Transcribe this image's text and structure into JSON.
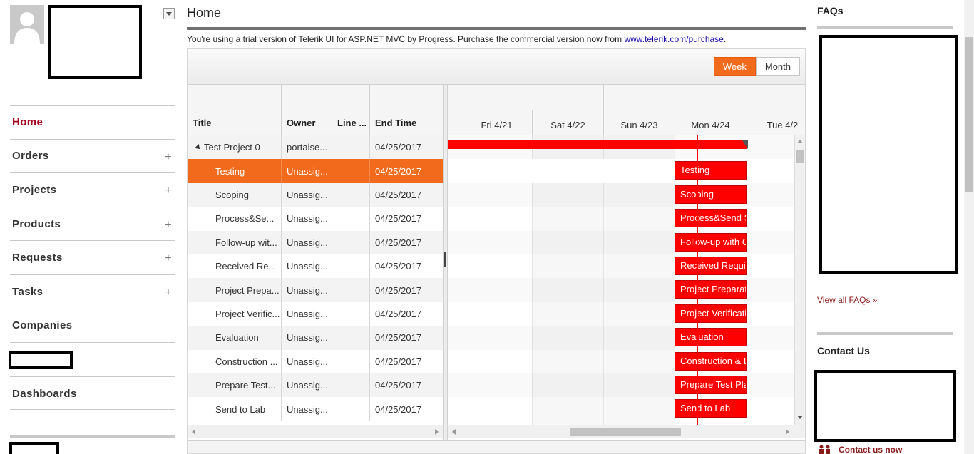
{
  "sidebar": {
    "nav": [
      {
        "label": "Home",
        "expandable": false,
        "active": true
      },
      {
        "label": "Orders",
        "expandable": true
      },
      {
        "label": "Projects",
        "expandable": true
      },
      {
        "label": "Products",
        "expandable": true
      },
      {
        "label": "Requests",
        "expandable": true
      },
      {
        "label": "Tasks",
        "expandable": true
      },
      {
        "label": "Companies",
        "expandable": false
      },
      {
        "label": "",
        "redacted": true
      },
      {
        "label": "Dashboards",
        "expandable": false
      }
    ],
    "plus_glyph": "+"
  },
  "main": {
    "title": "Home",
    "trial_notice": "You're using a trial version of Telerik UI for ASP.NET MVC by Progress. Purchase the commercial version now from",
    "trial_link": "www.telerik.com/purchase",
    "trial_suffix": "."
  },
  "gantt": {
    "views": [
      "Week",
      "Month"
    ],
    "selected_view": "Week",
    "columns": [
      "Title",
      "Owner",
      "Line ...",
      "End Time"
    ],
    "rows": [
      {
        "title": "Test Project 0",
        "owner": "portalse...",
        "line": "",
        "end": "04/25/2017",
        "summary": true
      },
      {
        "title": "Testing",
        "owner": "Unassig...",
        "line": "",
        "end": "04/25/2017",
        "selected": true
      },
      {
        "title": "Scoping",
        "owner": "Unassig...",
        "line": "",
        "end": "04/25/2017"
      },
      {
        "title": "Process&Se...",
        "owner": "Unassig...",
        "line": "",
        "end": "04/25/2017"
      },
      {
        "title": "Follow-up wit...",
        "owner": "Unassig...",
        "line": "",
        "end": "04/25/2017"
      },
      {
        "title": "Received Re...",
        "owner": "Unassig...",
        "line": "",
        "end": "04/25/2017"
      },
      {
        "title": "Project Prepa...",
        "owner": "Unassig...",
        "line": "",
        "end": "04/25/2017"
      },
      {
        "title": "Project Verific...",
        "owner": "Unassig...",
        "line": "",
        "end": "04/25/2017"
      },
      {
        "title": "Evaluation",
        "owner": "Unassig...",
        "line": "",
        "end": "04/25/2017"
      },
      {
        "title": "Construction ...",
        "owner": "Unassig...",
        "line": "",
        "end": "04/25/2017"
      },
      {
        "title": "Prepare Test...",
        "owner": "Unassig...",
        "line": "",
        "end": "04/25/2017"
      },
      {
        "title": "Send to Lab",
        "owner": "Unassig...",
        "line": "",
        "end": "04/25/2017"
      }
    ],
    "days": [
      "Fri 4/21",
      "Sat 4/22",
      "Sun 4/23",
      "Mon 4/24",
      "Tue 4/2"
    ],
    "tasks": [
      "Testing",
      "Scoping",
      "Process&Send S",
      "Follow-up with C",
      "Received Requir",
      "Project Preparati",
      "Project Verificatio",
      "Evaluation",
      "Construction & D",
      "Prepare Test Pla",
      "Send to Lab"
    ],
    "colors": {
      "accent": "#f26b1d",
      "task_bar": "#ff0000",
      "today_line": "#ff0000"
    }
  },
  "right": {
    "faqs_title": "FAQs",
    "faqs_link": "View all FAQs »",
    "contact_title": "Contact Us",
    "contact_link": "Contact us now"
  },
  "colors": {
    "brand_red": "#a2001d",
    "link_red": "#8b1a1a"
  }
}
